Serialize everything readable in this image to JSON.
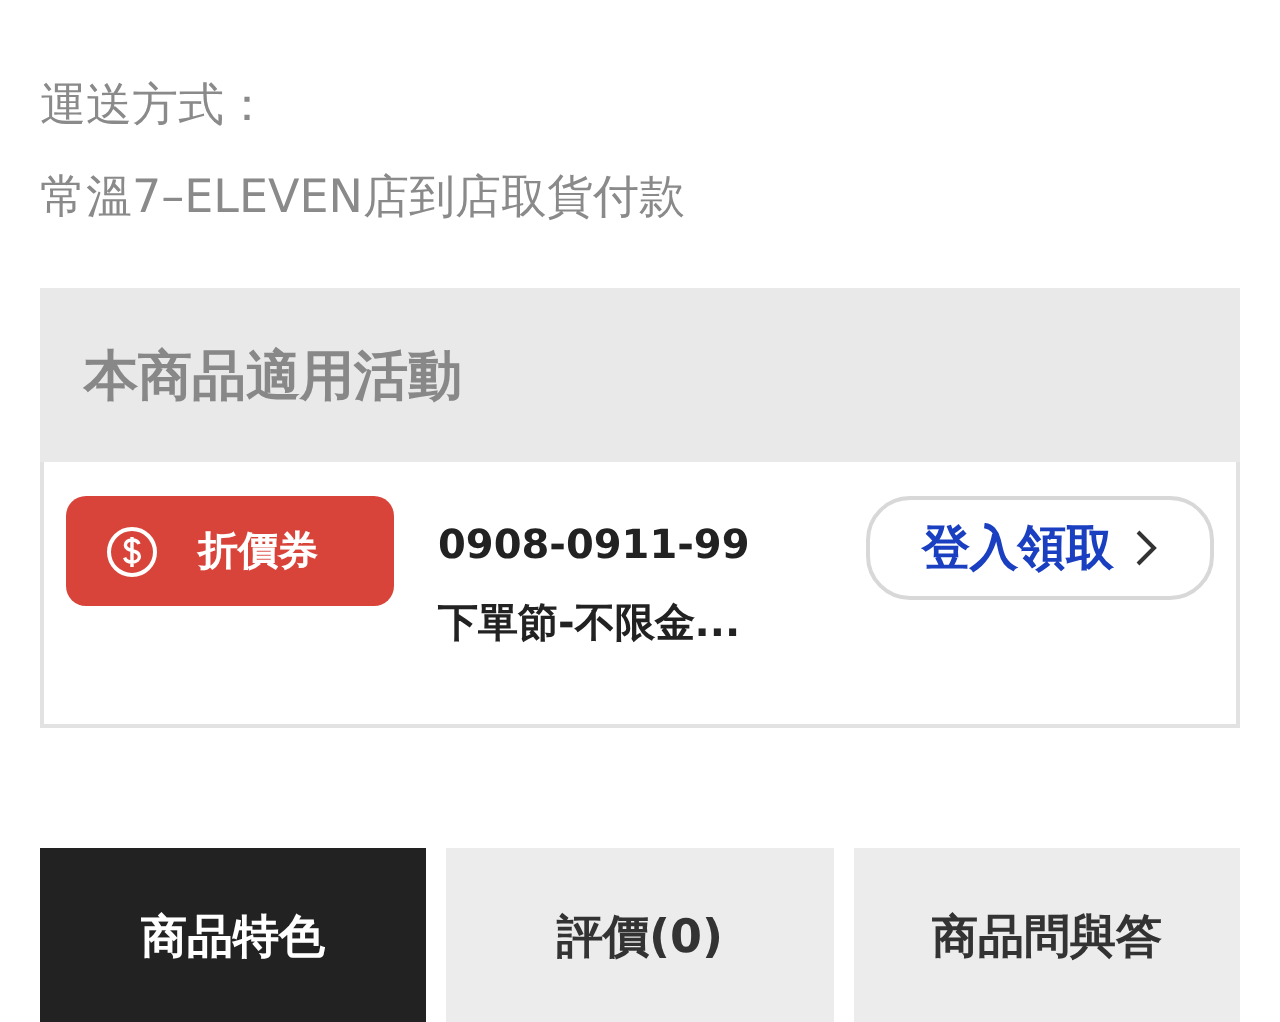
{
  "shipping": {
    "label": "運送方式：",
    "value": "常溫7–ELEVEN店到店取貨付款"
  },
  "promotions": {
    "title": "本商品適用活動",
    "items": [
      {
        "badge": "折價券",
        "code": "0908-0911-99",
        "name": "下單節-不限金...",
        "action": "登入領取"
      }
    ]
  },
  "tabs": [
    {
      "label": "商品特色",
      "selected": true
    },
    {
      "label": "評價(0)",
      "selected": false
    },
    {
      "label": "商品問與答",
      "selected": false
    }
  ]
}
